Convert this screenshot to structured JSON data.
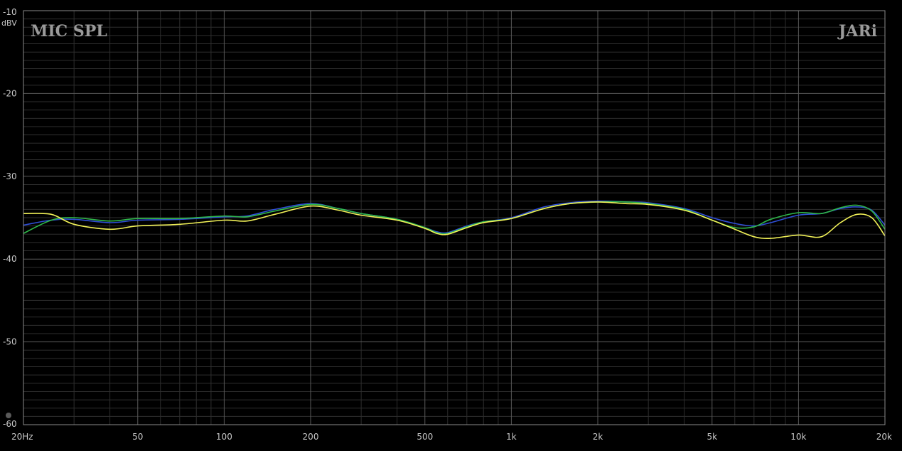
{
  "chart_data": {
    "type": "line",
    "title": "MIC SPL",
    "brand": "JARi",
    "ylabel": "dBV",
    "xlabel": "",
    "xscale": "log",
    "xlim": [
      20,
      20000
    ],
    "ylim": [
      -60,
      -10
    ],
    "grid": true,
    "x_ticks": [
      {
        "value": 20,
        "label": "20Hz"
      },
      {
        "value": 50,
        "label": "50"
      },
      {
        "value": 100,
        "label": "100"
      },
      {
        "value": 200,
        "label": "200"
      },
      {
        "value": 500,
        "label": "500"
      },
      {
        "value": 1000,
        "label": "1k"
      },
      {
        "value": 2000,
        "label": "2k"
      },
      {
        "value": 5000,
        "label": "5k"
      },
      {
        "value": 10000,
        "label": "10k"
      },
      {
        "value": 20000,
        "label": "20k"
      }
    ],
    "y_ticks": [
      {
        "value": -10,
        "label": "-10"
      },
      {
        "value": -20,
        "label": "-20"
      },
      {
        "value": -30,
        "label": "-30"
      },
      {
        "value": -40,
        "label": "-40"
      },
      {
        "value": -50,
        "label": "-50"
      },
      {
        "value": -60,
        "label": "-60"
      }
    ],
    "series": [
      {
        "color": "#2f4fd6",
        "points": [
          [
            20,
            -35.9
          ],
          [
            25,
            -35.3
          ],
          [
            30,
            -35.2
          ],
          [
            40,
            -35.6
          ],
          [
            50,
            -35.3
          ],
          [
            70,
            -35.2
          ],
          [
            100,
            -34.9
          ],
          [
            120,
            -34.8
          ],
          [
            150,
            -34.0
          ],
          [
            200,
            -33.3
          ],
          [
            250,
            -33.9
          ],
          [
            300,
            -34.5
          ],
          [
            400,
            -35.2
          ],
          [
            500,
            -36.2
          ],
          [
            550,
            -36.7
          ],
          [
            600,
            -36.8
          ],
          [
            700,
            -36.0
          ],
          [
            800,
            -35.5
          ],
          [
            1000,
            -35.0
          ],
          [
            1300,
            -33.7
          ],
          [
            1600,
            -33.2
          ],
          [
            2000,
            -33.0
          ],
          [
            2500,
            -33.1
          ],
          [
            3000,
            -33.2
          ],
          [
            4000,
            -33.9
          ],
          [
            5000,
            -35.0
          ],
          [
            6000,
            -35.7
          ],
          [
            7000,
            -36.0
          ],
          [
            8000,
            -35.6
          ],
          [
            10000,
            -34.7
          ],
          [
            12000,
            -34.5
          ],
          [
            14000,
            -33.9
          ],
          [
            16000,
            -33.7
          ],
          [
            18000,
            -34.1
          ],
          [
            20000,
            -35.9
          ]
        ]
      },
      {
        "color": "#2fb84a",
        "points": [
          [
            20,
            -36.9
          ],
          [
            25,
            -35.3
          ],
          [
            30,
            -35.0
          ],
          [
            40,
            -35.4
          ],
          [
            50,
            -35.1
          ],
          [
            70,
            -35.1
          ],
          [
            100,
            -34.8
          ],
          [
            120,
            -34.9
          ],
          [
            150,
            -34.2
          ],
          [
            200,
            -33.4
          ],
          [
            250,
            -33.9
          ],
          [
            300,
            -34.5
          ],
          [
            400,
            -35.2
          ],
          [
            500,
            -36.2
          ],
          [
            550,
            -36.8
          ],
          [
            600,
            -36.9
          ],
          [
            700,
            -36.1
          ],
          [
            800,
            -35.5
          ],
          [
            1000,
            -35.1
          ],
          [
            1300,
            -33.9
          ],
          [
            1600,
            -33.3
          ],
          [
            2000,
            -33.1
          ],
          [
            2500,
            -33.1
          ],
          [
            3000,
            -33.3
          ],
          [
            4000,
            -34.0
          ],
          [
            5000,
            -35.3
          ],
          [
            6000,
            -36.2
          ],
          [
            7000,
            -36.1
          ],
          [
            8000,
            -35.2
          ],
          [
            10000,
            -34.4
          ],
          [
            12000,
            -34.5
          ],
          [
            14000,
            -33.8
          ],
          [
            16000,
            -33.5
          ],
          [
            18000,
            -34.2
          ],
          [
            20000,
            -36.4
          ]
        ]
      },
      {
        "color": "#f2f258",
        "points": [
          [
            20,
            -34.5
          ],
          [
            25,
            -34.6
          ],
          [
            30,
            -35.8
          ],
          [
            40,
            -36.4
          ],
          [
            50,
            -36.0
          ],
          [
            70,
            -35.8
          ],
          [
            100,
            -35.3
          ],
          [
            120,
            -35.4
          ],
          [
            150,
            -34.6
          ],
          [
            200,
            -33.6
          ],
          [
            250,
            -34.1
          ],
          [
            300,
            -34.7
          ],
          [
            400,
            -35.3
          ],
          [
            500,
            -36.3
          ],
          [
            550,
            -36.9
          ],
          [
            600,
            -37.0
          ],
          [
            700,
            -36.2
          ],
          [
            800,
            -35.6
          ],
          [
            1000,
            -35.1
          ],
          [
            1300,
            -33.9
          ],
          [
            1600,
            -33.3
          ],
          [
            2000,
            -33.1
          ],
          [
            2500,
            -33.3
          ],
          [
            3000,
            -33.4
          ],
          [
            4000,
            -34.1
          ],
          [
            5000,
            -35.3
          ],
          [
            6000,
            -36.4
          ],
          [
            7000,
            -37.3
          ],
          [
            8000,
            -37.5
          ],
          [
            10000,
            -37.1
          ],
          [
            12000,
            -37.3
          ],
          [
            14000,
            -35.6
          ],
          [
            16000,
            -34.6
          ],
          [
            18000,
            -35.0
          ],
          [
            20000,
            -37.2
          ]
        ]
      }
    ]
  }
}
